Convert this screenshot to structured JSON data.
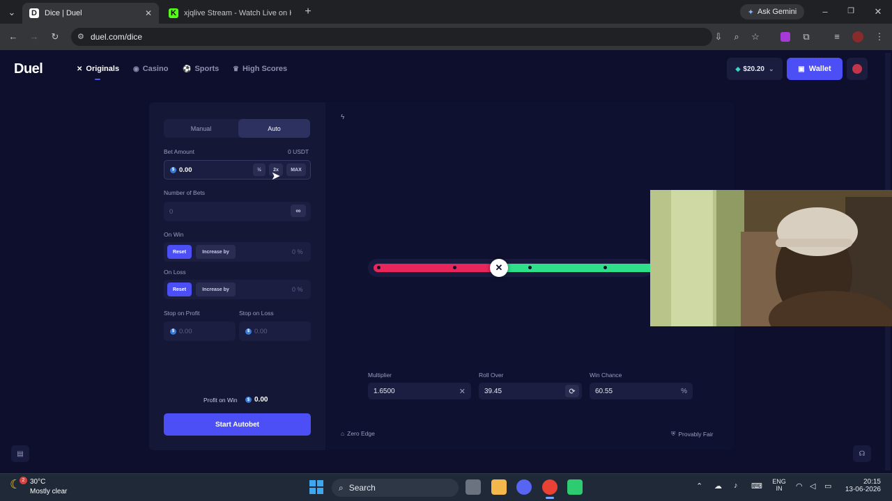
{
  "browser": {
    "tabs": [
      {
        "favicon": "D",
        "title": "Dice | Duel",
        "active": true
      },
      {
        "favicon": "K",
        "title": "xjqlive Stream - Watch Live on K",
        "active": false
      }
    ],
    "url": "duel.com/dice",
    "gemini_label": "Ask Gemini"
  },
  "site": {
    "logo": "Duel",
    "nav": [
      {
        "label": "Originals",
        "icon": "crossed-swords-icon",
        "active": true
      },
      {
        "label": "Casino",
        "icon": "chip-icon",
        "active": false
      },
      {
        "label": "Sports",
        "icon": "ball-icon",
        "active": false
      },
      {
        "label": "High Scores",
        "icon": "trophy-icon",
        "active": false
      }
    ],
    "balance": "$20.20",
    "wallet_label": "Wallet"
  },
  "panel": {
    "mode_manual": "Manual",
    "mode_auto": "Auto",
    "bet_amount_label": "Bet Amount",
    "bet_amount_currency": "0 USDT",
    "bet_amount_value": "0.00",
    "half_label": "½",
    "double_label": "2x",
    "max_label": "MAX",
    "num_bets_label": "Number of Bets",
    "num_bets_value": "0",
    "infinity_label": "∞",
    "on_win_label": "On Win",
    "on_loss_label": "On Loss",
    "reset_label": "Reset",
    "increase_label": "Increase by",
    "on_win_value": "0",
    "on_loss_value": "0",
    "percent": "%",
    "stop_profit_label": "Stop on Profit",
    "stop_loss_label": "Stop on Loss",
    "stop_profit_value": "0.00",
    "stop_loss_value": "0.00",
    "profit_on_win_label": "Profit on Win",
    "profit_on_win_value": "0.00",
    "start_label": "Start Autobet"
  },
  "game": {
    "roll_over_fraction": 0.3945,
    "multiplier_label": "Multiplier",
    "multiplier_value": "1.6500",
    "roll_over_label": "Roll Over",
    "roll_over_value": "39.45",
    "win_chance_label": "Win Chance",
    "win_chance_value": "60.55",
    "zero_edge_label": "Zero Edge",
    "provably_fair_label": "Provably Fair"
  },
  "taskbar": {
    "weather_temp": "30°C",
    "weather_desc": "Mostly clear",
    "weather_badge": "2",
    "search_label": "Search",
    "lang_line1": "ENG",
    "lang_line2": "IN",
    "time": "20:15",
    "date": "13-06-2026"
  },
  "colors": {
    "accent": "#4b4ff5",
    "lose_red": "#e9265c",
    "win_green": "#2ee08a"
  }
}
